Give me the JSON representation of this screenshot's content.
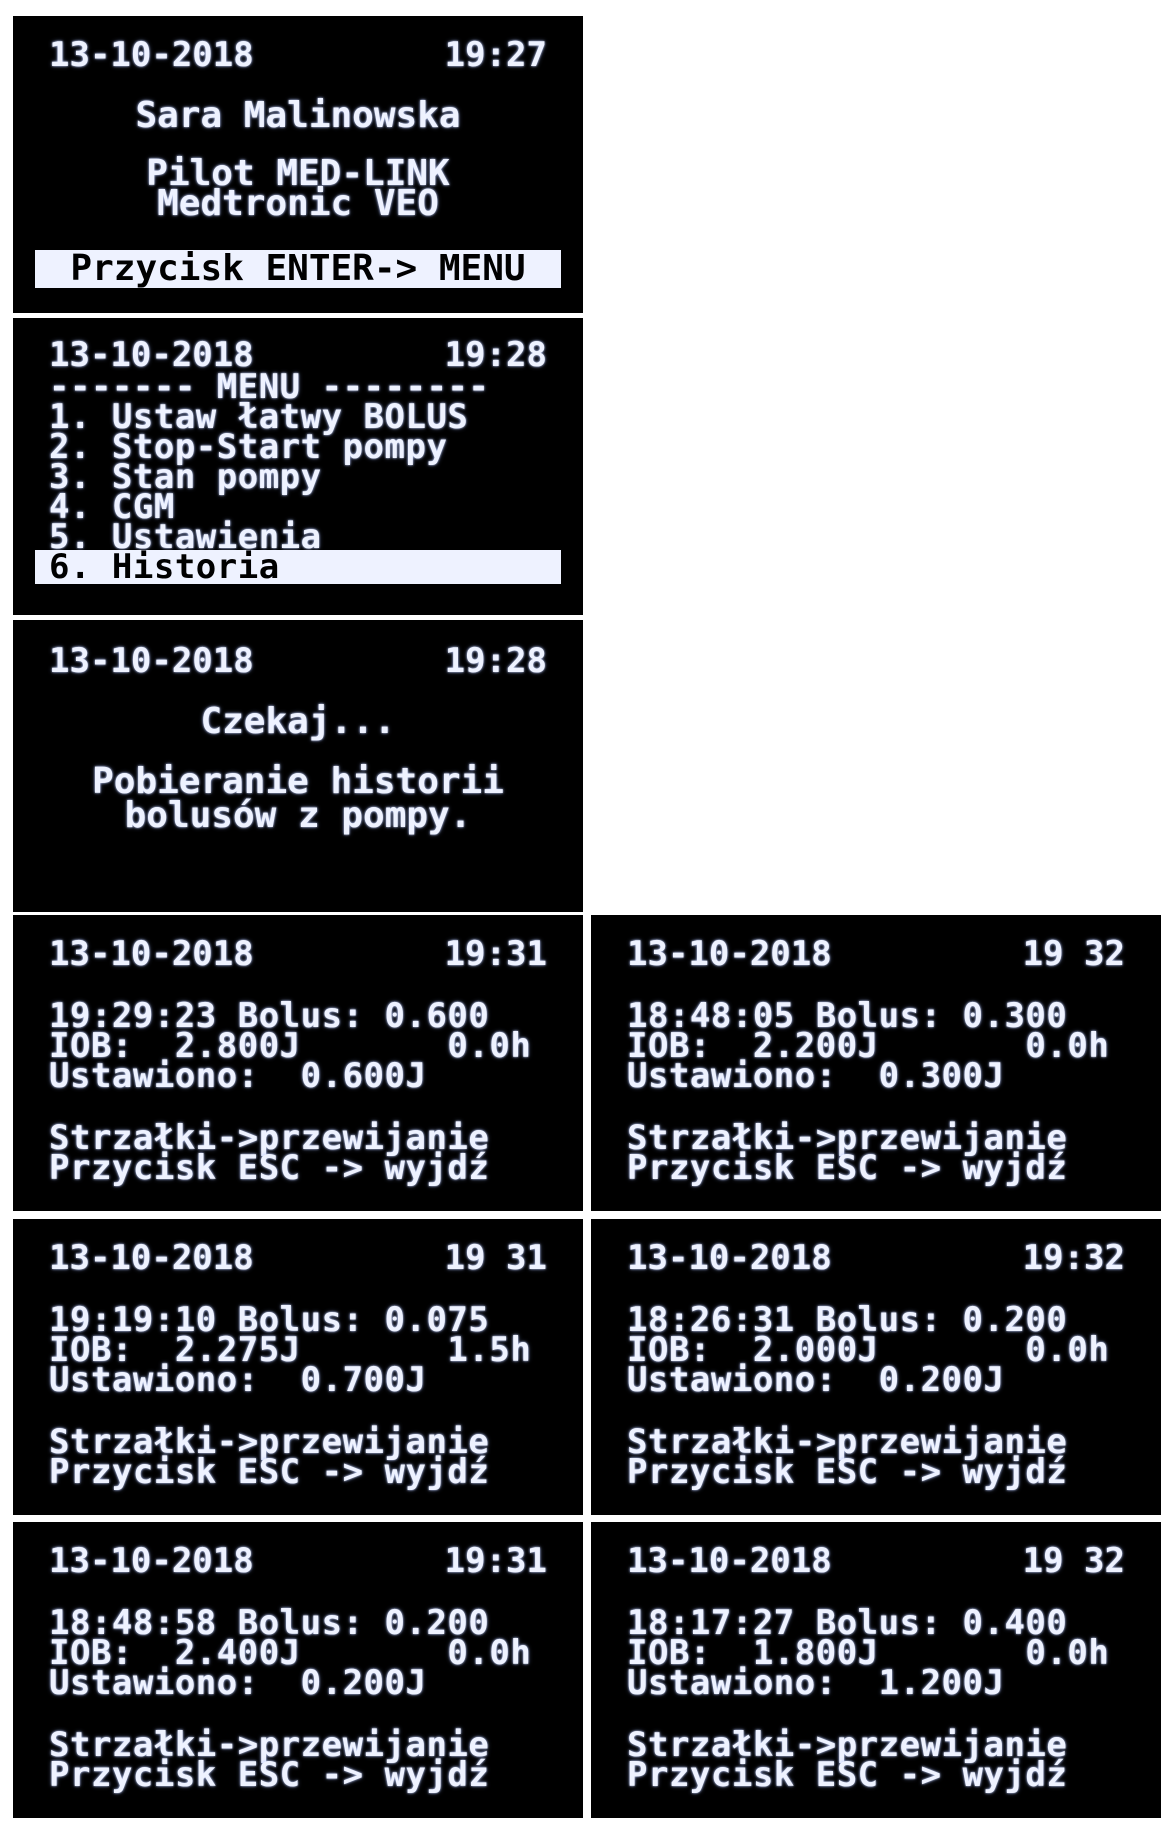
{
  "screens": [
    {
      "date": "13-10-2018",
      "time": "19:27",
      "user": "Sara Malinowska",
      "line1": "Pilot MED-LINK",
      "line2": "Medtronic VEO",
      "footer": "Przycisk ENTER-> MENU"
    },
    {
      "date": "13-10-2018",
      "time": "19:28",
      "menu_title": "------- MENU --------",
      "items": [
        "1. Ustaw łatwy BOLUS",
        "2. Stop-Start pompy",
        "3. Stan pompy",
        "4. CGM",
        "5. Ustawienia",
        "6. Historia"
      ]
    },
    {
      "date": "13-10-2018",
      "time": "19:28",
      "title": "Czekaj...",
      "line1": "Pobieranie historii",
      "line2": "bolusów z pompy."
    }
  ],
  "history": [
    {
      "date": "13-10-2018",
      "time": "19:31",
      "entry": "19:29:23 Bolus: 0.600",
      "iob": "IOB:  2.800J       0.0h",
      "set": "Ustawiono:  0.600J",
      "hint1": "Strzałki->przewijanie",
      "hint2": "Przycisk ESC -> wyjdź"
    },
    {
      "date": "13-10-2018",
      "time": "19 32",
      "entry": "18:48:05 Bolus: 0.300",
      "iob": "IOB:  2.200J       0.0h",
      "set": "Ustawiono:  0.300J",
      "hint1": "Strzałki->przewijanie",
      "hint2": "Przycisk ESC -> wyjdź"
    },
    {
      "date": "13-10-2018",
      "time": "19 31",
      "entry": "19:19:10 Bolus: 0.075",
      "iob": "IOB:  2.275J       1.5h",
      "set": "Ustawiono:  0.700J",
      "hint1": "Strzałki->przewijanie",
      "hint2": "Przycisk ESC -> wyjdź"
    },
    {
      "date": "13-10-2018",
      "time": "19:32",
      "entry": "18:26:31 Bolus: 0.200",
      "iob": "IOB:  2.000J       0.0h",
      "set": "Ustawiono:  0.200J",
      "hint1": "Strzałki->przewijanie",
      "hint2": "Przycisk ESC -> wyjdź"
    },
    {
      "date": "13-10-2018",
      "time": "19:31",
      "entry": "18:48:58 Bolus: 0.200",
      "iob": "IOB:  2.400J       0.0h",
      "set": "Ustawiono:  0.200J",
      "hint1": "Strzałki->przewijanie",
      "hint2": "Przycisk ESC -> wyjdź"
    },
    {
      "date": "13-10-2018",
      "time": "19 32",
      "entry": "18:17:27 Bolus: 0.400",
      "iob": "IOB:  1.800J       0.0h",
      "set": "Ustawiono:  1.200J",
      "hint1": "Strzałki->przewijanie",
      "hint2": "Przycisk ESC -> wyjdź"
    }
  ]
}
